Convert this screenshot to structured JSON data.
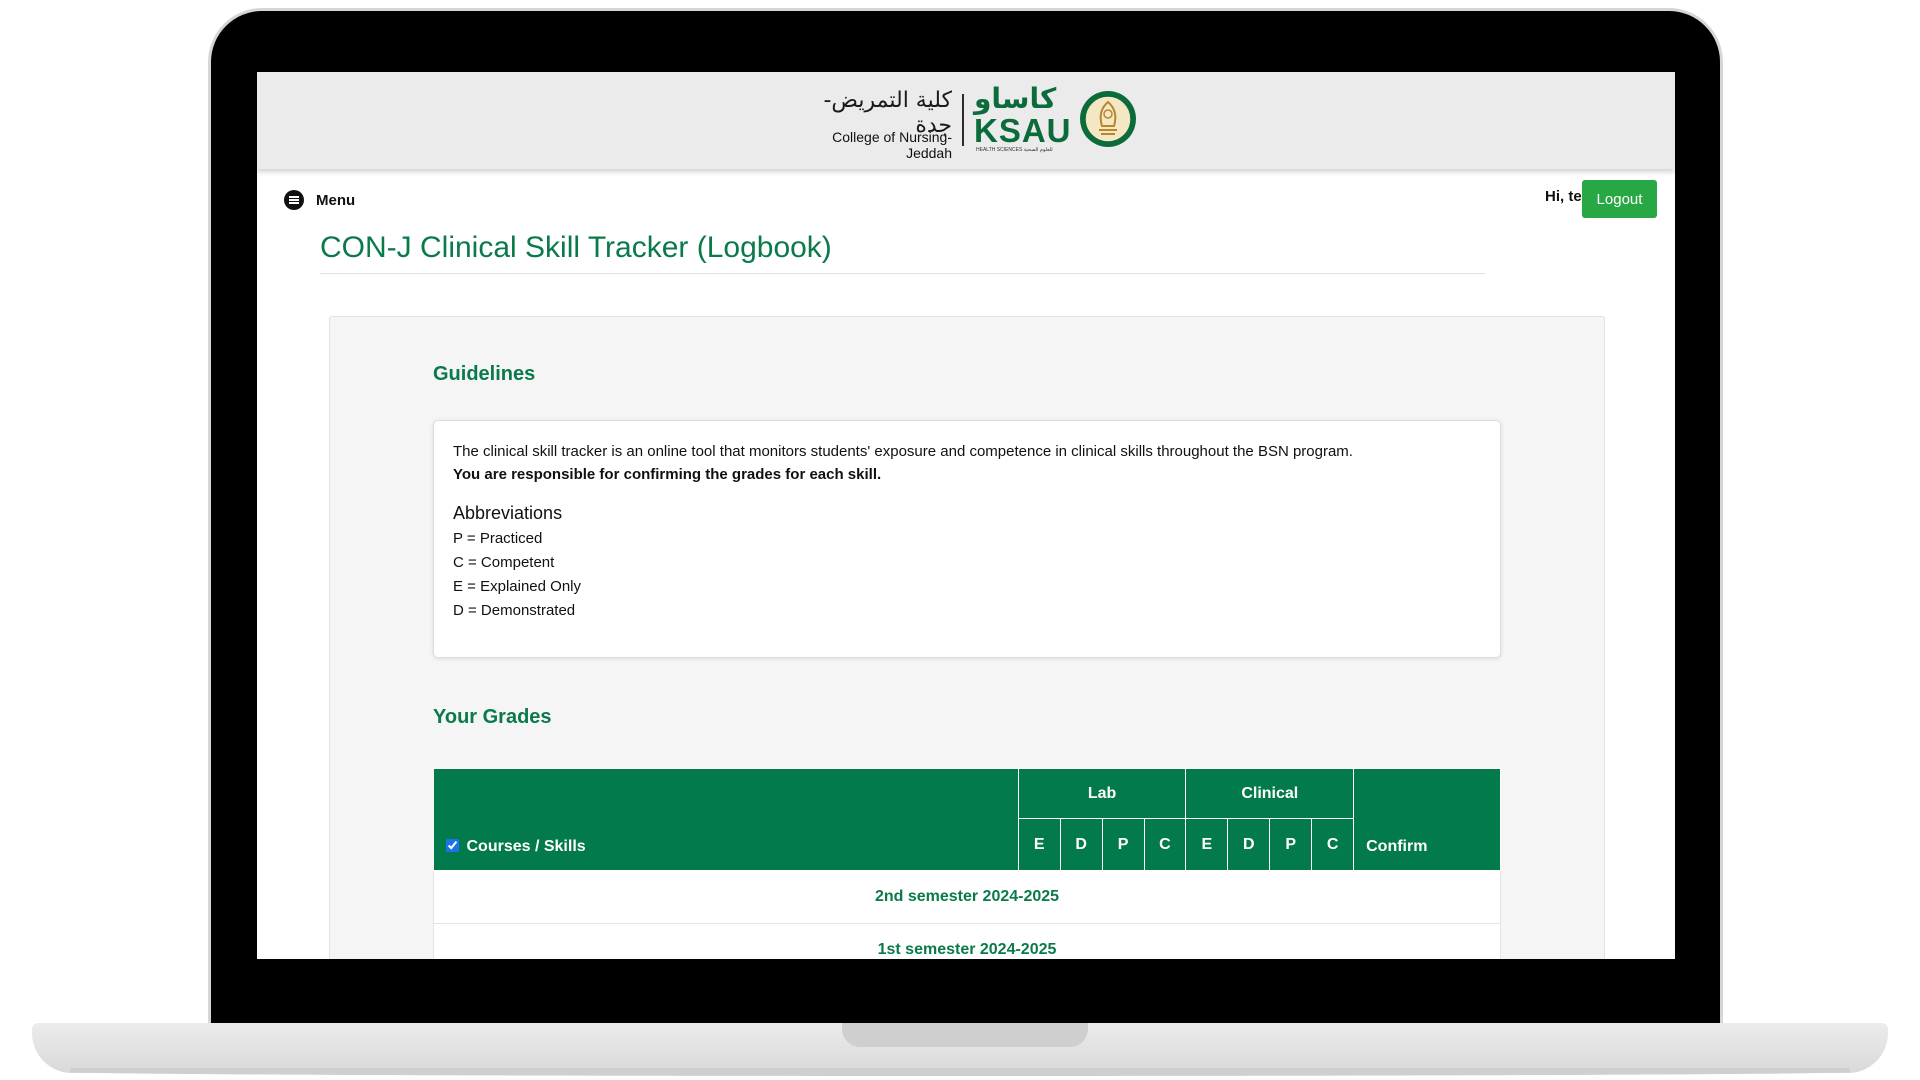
{
  "header": {
    "college_ar": "كلية التمريض-جدة",
    "college_en": "College of Nursing-Jeddah",
    "ksau_ar": "كاساو",
    "ksau_en": "KSAU",
    "ksau_sub": "HEALTH SCIENCES  للعلوم الصحية",
    "brand_color": "#0b6b3a"
  },
  "topbar": {
    "menu_label": "Menu",
    "greeting": "Hi, test",
    "logout_label": "Logout",
    "logout_color": "#28a745"
  },
  "page": {
    "title": "CON-J Clinical Skill Tracker (Logbook)",
    "accent_color": "#0a7a4a"
  },
  "guidelines": {
    "heading": "Guidelines",
    "intro": "The clinical skill tracker is an online tool that monitors students' exposure and competence in clinical skills throughout the BSN program.",
    "responsibility": "You are responsible for confirming the grades for each skill.",
    "abbreviations_title": "Abbreviations",
    "abbreviations": [
      "P = Practiced",
      "C = Competent",
      "E = Explained Only",
      "D = Demonstrated"
    ]
  },
  "grades": {
    "heading": "Your Grades",
    "header_color": "#037a4b",
    "columns": {
      "courses_skills": "Courses / Skills",
      "select_all_checked": true,
      "lab": "Lab",
      "clinical": "Clinical",
      "sub": [
        "E",
        "D",
        "P",
        "C"
      ],
      "confirm": "Confirm"
    },
    "semesters": [
      "2nd semester 2024-2025",
      "1st semester 2024-2025"
    ]
  }
}
